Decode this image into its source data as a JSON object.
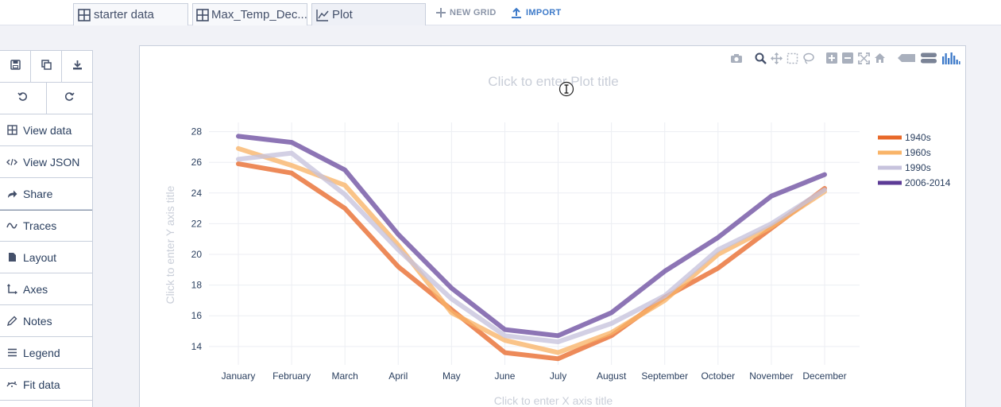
{
  "tabs": [
    {
      "label": "starter data",
      "icon": "grid-icon"
    },
    {
      "label": "Max_Temp_Dec...",
      "icon": "grid-icon"
    },
    {
      "label": "Plot",
      "icon": "line-chart-icon"
    }
  ],
  "top_actions": {
    "new_grid": "NEW GRID",
    "import": "IMPORT"
  },
  "sidebar": {
    "icon_buttons": [
      "save-icon",
      "copy-icon",
      "download-icon",
      "undo-icon",
      "redo-icon"
    ],
    "items": [
      {
        "label": "View data",
        "icon": "grid-icon"
      },
      {
        "label": "View JSON",
        "icon": "code-icon"
      },
      {
        "label": "Share",
        "icon": "share-icon"
      },
      {
        "label": "Traces",
        "icon": "traces-icon"
      },
      {
        "label": "Layout",
        "icon": "document-icon"
      },
      {
        "label": "Axes",
        "icon": "axes-icon"
      },
      {
        "label": "Notes",
        "icon": "pencil-icon"
      },
      {
        "label": "Legend",
        "icon": "list-icon"
      },
      {
        "label": "Fit data",
        "icon": "fit-icon"
      }
    ]
  },
  "plot": {
    "title_placeholder": "Click to enter Plot title",
    "xaxis_placeholder": "Click to enter X axis title",
    "yaxis_placeholder": "Click to enter Y axis title"
  },
  "colors": {
    "accent": "#3d7ac9",
    "1940s": "#e8692a",
    "1960s": "#f9b468",
    "1990s": "#c7c3dd",
    "2006-2014": "#5c3b96"
  },
  "chart_data": {
    "type": "line",
    "categories": [
      "January",
      "February",
      "March",
      "April",
      "May",
      "June",
      "July",
      "August",
      "September",
      "October",
      "November",
      "December"
    ],
    "ylim": [
      12.8,
      28.6
    ],
    "yticks": [
      14,
      16,
      18,
      20,
      22,
      24,
      26,
      28
    ],
    "grid": true,
    "legend_position": "top-right",
    "series": [
      {
        "name": "1940s",
        "values": [
          25.9,
          25.3,
          23.0,
          19.2,
          16.4,
          13.6,
          13.2,
          14.7,
          17.2,
          19.1,
          21.7,
          24.3
        ]
      },
      {
        "name": "1960s",
        "values": [
          26.9,
          25.8,
          24.5,
          20.6,
          16.2,
          14.4,
          13.6,
          14.9,
          17.0,
          20.0,
          21.8,
          24.1
        ]
      },
      {
        "name": "1990s",
        "values": [
          26.2,
          26.6,
          23.9,
          20.3,
          17.1,
          14.7,
          14.3,
          15.5,
          17.3,
          20.3,
          22.0,
          24.2
        ]
      },
      {
        "name": "2006-2014",
        "values": [
          27.7,
          27.3,
          25.5,
          21.3,
          17.8,
          15.1,
          14.7,
          16.2,
          18.9,
          21.1,
          23.8,
          25.2
        ]
      }
    ]
  }
}
